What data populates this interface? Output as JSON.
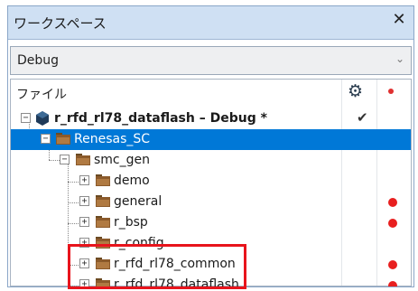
{
  "window": {
    "title": "ワークスペース",
    "close_glyph": "✕"
  },
  "config": {
    "value": "Debug",
    "arrow": "⌄"
  },
  "tree": {
    "header": {
      "label": "ファイル",
      "gear_icon": "gear-icon",
      "build_dot_color": "#e03030"
    },
    "items": [
      {
        "label": "r_rfd_rl78_dataflash – Debug *",
        "type": "project",
        "checked": true,
        "build": false
      },
      {
        "label": "Renesas_SC",
        "type": "folder",
        "selected": true,
        "build": false
      },
      {
        "label": "smc_gen",
        "type": "folder",
        "build": false
      },
      {
        "label": "demo",
        "type": "folder",
        "build": false
      },
      {
        "label": "general",
        "type": "folder",
        "build": true
      },
      {
        "label": "r_bsp",
        "type": "folder",
        "build": true
      },
      {
        "label": "r_config",
        "type": "folder",
        "build": false
      },
      {
        "label": "r_rfd_rl78_common",
        "type": "folder",
        "build": true
      },
      {
        "label": "r_rfd_rl78_dataflash",
        "type": "folder",
        "build": true
      }
    ],
    "check_glyph": "✔",
    "expander_minus": "−",
    "expander_plus": "+"
  },
  "colors": {
    "selection": "#0078d7",
    "highlight_box": "#e8141c",
    "build_dot": "#e81f1f"
  }
}
